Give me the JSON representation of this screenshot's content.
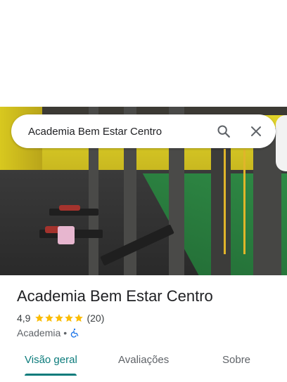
{
  "search": {
    "query": "Academia Bem Estar Centro"
  },
  "place": {
    "name": "Academia Bem Estar Centro",
    "rating": "4,9",
    "stars": 5,
    "reviews_count": "(20)",
    "category": "Academia",
    "separator": "•"
  },
  "tabs": [
    {
      "label": "Visão geral",
      "active": true
    },
    {
      "label": "Avaliações",
      "active": false
    },
    {
      "label": "Sobre",
      "active": false
    }
  ],
  "colors": {
    "accent": "#0b7b7b",
    "star": "#fbbc04",
    "accessibility": "#1a73e8"
  },
  "icons": [
    "search-icon",
    "close-icon",
    "star-icon",
    "wheelchair-accessible-icon"
  ]
}
